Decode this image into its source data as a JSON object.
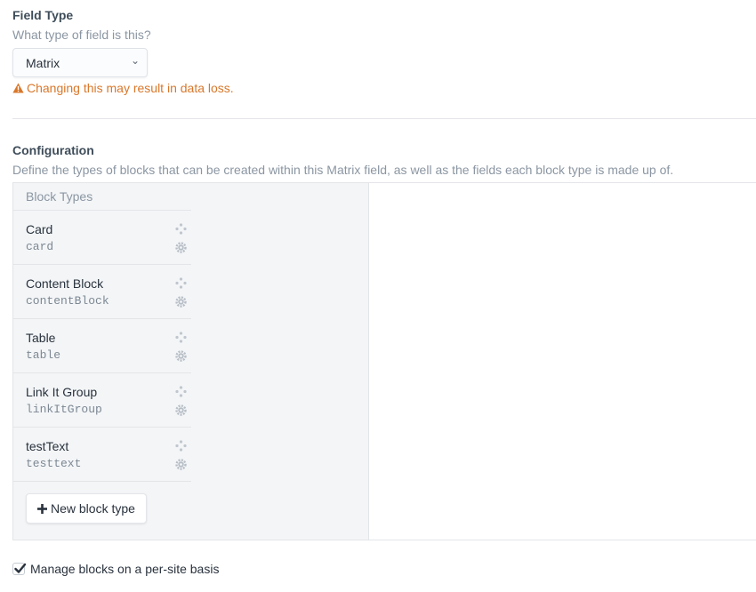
{
  "field_type": {
    "label": "Field Type",
    "instructions": "What type of field is this?",
    "selected": "Matrix",
    "warning": "Changing this may result in data loss."
  },
  "configuration": {
    "label": "Configuration",
    "instructions": "Define the types of blocks that can be created within this Matrix field, as well as the fields each block type is made up of.",
    "block_types_header": "Block Types",
    "block_types": [
      {
        "name": "Card",
        "handle": "card"
      },
      {
        "name": "Content Block",
        "handle": "contentBlock"
      },
      {
        "name": "Table",
        "handle": "table"
      },
      {
        "name": "Link It Group",
        "handle": "linkItGroup"
      },
      {
        "name": "testText",
        "handle": "testtext"
      }
    ],
    "new_block_type_label": "New block type"
  },
  "propagation": {
    "label": "Manage blocks on a per-site basis",
    "checked": true
  },
  "colors": {
    "warning": "#d9772a",
    "text": "#29323d",
    "muted": "#8b96a2"
  }
}
